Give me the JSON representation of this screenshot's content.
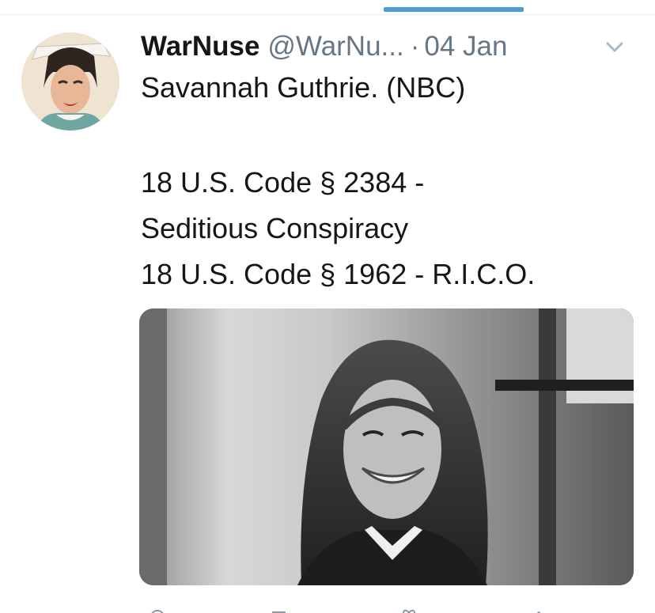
{
  "tab_bar": {
    "active_indicator_color": "#4a9fd8"
  },
  "tweet": {
    "author_name": "WarNuse",
    "author_handle": "@WarNu...",
    "separator": "·",
    "date": "04 Jan",
    "avatar_icon": "profile-photo-avatar",
    "menu_icon": "chevron-down-icon",
    "text_lines": [
      "Savannah Guthrie. (NBC)",
      "18 U.S. Code § 2384 -",
      "Seditious Conspiracy",
      "18 U.S. Code § 1962  - R.I.C.O."
    ],
    "media_icon": "photo-woman-smiling",
    "actions": [
      "reply-icon",
      "retweet-icon",
      "like-icon",
      "share-icon"
    ]
  },
  "colors": {
    "text_primary": "#14171a",
    "text_secondary": "#657786",
    "accent": "#4a9fd8"
  }
}
